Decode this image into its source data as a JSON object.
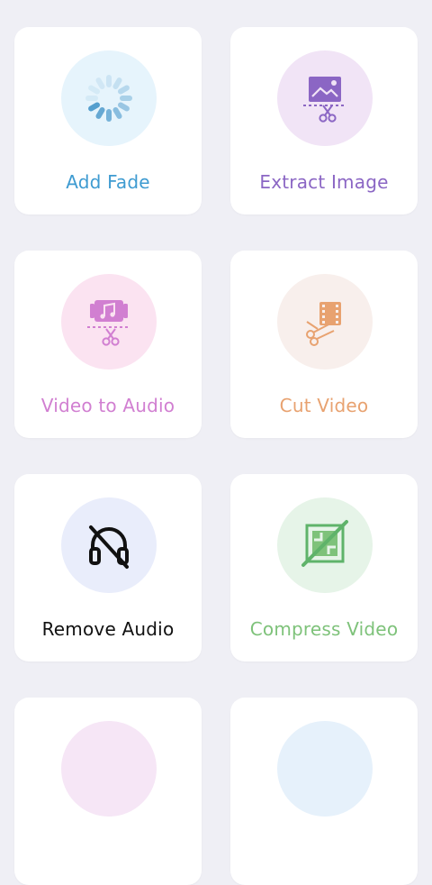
{
  "tools": [
    {
      "label": "Add Fade",
      "icon": "loading-spinner-icon",
      "label_color": "#3e9bd1",
      "circle_color": "#e6f4fc"
    },
    {
      "label": "Extract Image",
      "icon": "image-scissors-icon",
      "label_color": "#8b66c4",
      "circle_color": "#f1e4f6"
    },
    {
      "label": "Video to Audio",
      "icon": "music-scissors-icon",
      "label_color": "#d17fd1",
      "circle_color": "#fbe3f1"
    },
    {
      "label": "Cut Video",
      "icon": "film-scissors-icon",
      "label_color": "#e8a270",
      "circle_color": "#f8efec"
    },
    {
      "label": "Remove Audio",
      "icon": "headphones-off-icon",
      "label_color": "#111111",
      "circle_color": "#e9edfb"
    },
    {
      "label": "Compress Video",
      "icon": "compress-icon",
      "label_color": "#7ec27a",
      "circle_color": "#e6f4e8"
    }
  ]
}
